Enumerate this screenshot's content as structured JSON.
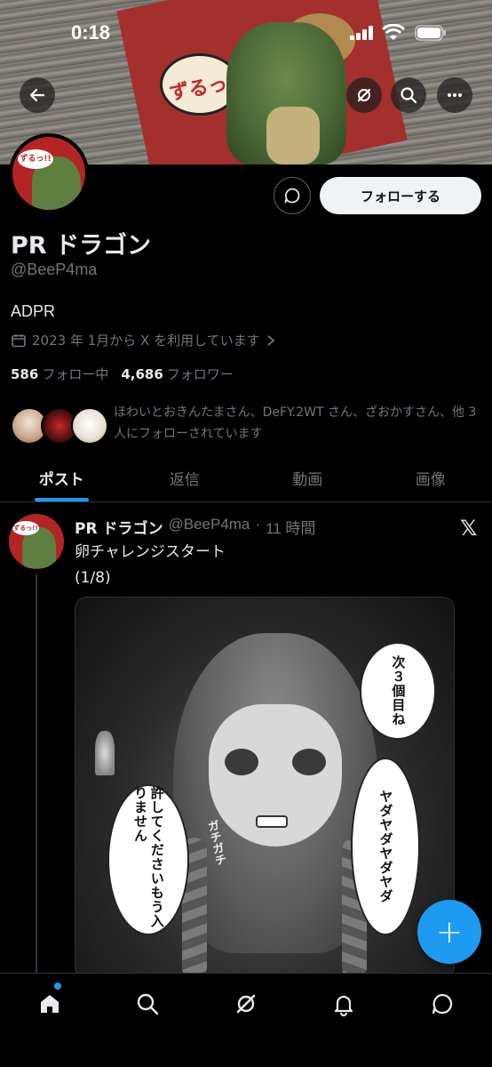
{
  "status_bar": {
    "time": "0:18"
  },
  "banner": {
    "text": "ずるっ!!"
  },
  "profile": {
    "avatar_text": "ずるっ!!",
    "display_name": "PR ドラゴン",
    "handle": "@BeeP4ma",
    "bio": "ADPR",
    "joined": "2023 年 1月から X を利用しています",
    "following_count": "586",
    "following_label": "フォロー中",
    "followers_count": "4,686",
    "followers_label": "フォロワー",
    "followed_by_text": "ほわいとおきんたまさん、DeFY.2WT さん、ざおかすさん、他 3 人にフォローされています",
    "follow_button_label": "フォローする"
  },
  "tabs": [
    {
      "label": "ポスト",
      "active": true
    },
    {
      "label": "返信",
      "active": false
    },
    {
      "label": "動画",
      "active": false
    },
    {
      "label": "画像",
      "active": false
    }
  ],
  "post": {
    "author_name": "PR ドラゴン",
    "author_handle": "@BeeP4ma",
    "time": "11 時間",
    "text_line1": "卵チャレンジスタート",
    "text_line2": "(1/8)",
    "image_bubbles": {
      "b1": "次３個目ね",
      "b2": "ヤダヤダヤダヤダ",
      "b3": "許してくださいもう入りません",
      "sfx": "ガチガチ"
    }
  },
  "fab_label": "+",
  "colors": {
    "accent": "#1d9bf0",
    "background": "#000000",
    "muted": "#71767b"
  },
  "icons": [
    "back-arrow-icon",
    "grok-icon",
    "search-icon",
    "more-icon",
    "message-icon",
    "calendar-icon",
    "chevron-right-icon",
    "x-logo-icon",
    "home-icon",
    "explore-icon",
    "notifications-icon",
    "messages-icon"
  ]
}
